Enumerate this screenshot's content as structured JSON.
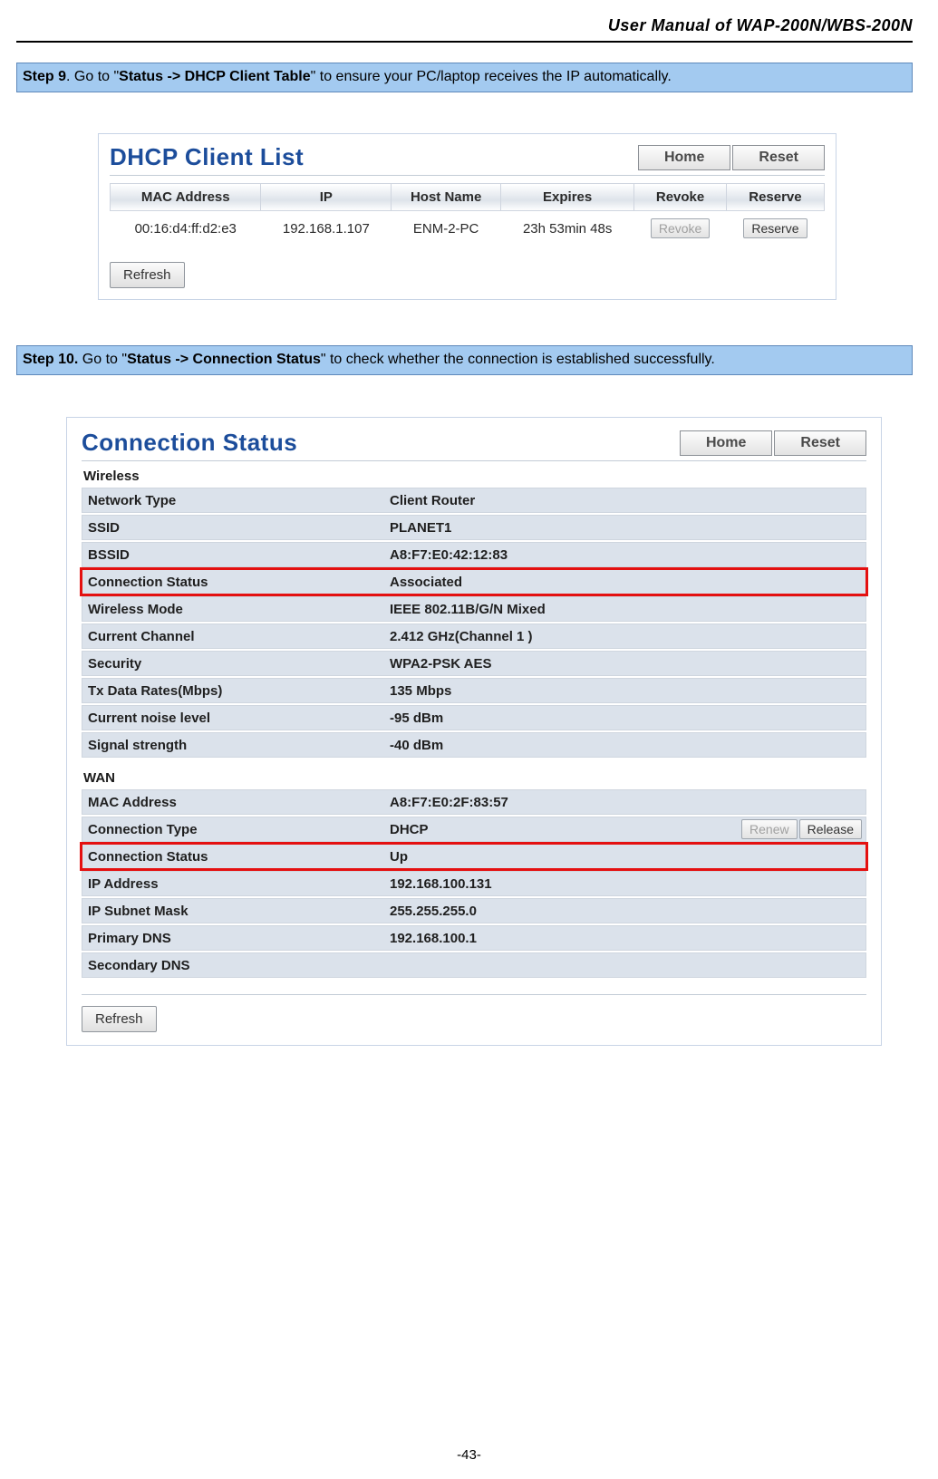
{
  "doc": {
    "header": "User Manual of WAP-200N/WBS-200N",
    "page_number": "-43-"
  },
  "step9": {
    "label": "Step 9",
    "text_before": ". Go to \"",
    "bold_path": "Status -> DHCP Client Table",
    "text_after": "\" to ensure your PC/laptop receives the IP automatically."
  },
  "step10": {
    "label": "Step 10.",
    "text_before": " Go to \"",
    "bold_path": "Status -> Connection Status",
    "text_after": "\" to check whether the connection is established successfully."
  },
  "dhcp": {
    "title": "DHCP Client List",
    "btn_home": "Home",
    "btn_reset": "Reset",
    "cols": {
      "mac": "MAC Address",
      "ip": "IP",
      "host": "Host Name",
      "expires": "Expires",
      "revoke": "Revoke",
      "reserve": "Reserve"
    },
    "row": {
      "mac": "00:16:d4:ff:d2:e3",
      "ip": "192.168.1.107",
      "host": "ENM-2-PC",
      "expires": "23h 53min 48s",
      "revoke_btn": "Revoke",
      "reserve_btn": "Reserve"
    },
    "refresh": "Refresh"
  },
  "conn": {
    "title": "Connection Status",
    "btn_home": "Home",
    "btn_reset": "Reset",
    "wireless_label": "Wireless",
    "wireless": {
      "network_type": {
        "k": "Network Type",
        "v": "Client Router"
      },
      "ssid": {
        "k": "SSID",
        "v": "PLANET1"
      },
      "bssid": {
        "k": "BSSID",
        "v": "A8:F7:E0:42:12:83"
      },
      "conn_status": {
        "k": "Connection Status",
        "v": "Associated"
      },
      "mode": {
        "k": "Wireless Mode",
        "v": "IEEE 802.11B/G/N Mixed"
      },
      "channel": {
        "k": "Current Channel",
        "v": "2.412 GHz(Channel 1 )"
      },
      "security": {
        "k": "Security",
        "v": "WPA2-PSK AES"
      },
      "tx": {
        "k": "Tx Data Rates(Mbps)",
        "v": "135 Mbps"
      },
      "noise": {
        "k": "Current noise level",
        "v": "-95 dBm"
      },
      "signal": {
        "k": "Signal strength",
        "v": "-40 dBm"
      }
    },
    "wan_label": "WAN",
    "wan": {
      "mac": {
        "k": "MAC Address",
        "v": "A8:F7:E0:2F:83:57"
      },
      "ctype": {
        "k": "Connection Type",
        "v": "DHCP"
      },
      "renew_btn": "Renew",
      "release_btn": "Release",
      "conn_status": {
        "k": "Connection Status",
        "v": "Up"
      },
      "ip": {
        "k": "IP Address",
        "v": "192.168.100.131"
      },
      "mask": {
        "k": "IP Subnet Mask",
        "v": "255.255.255.0"
      },
      "dns1": {
        "k": "Primary DNS",
        "v": "192.168.100.1"
      },
      "dns2": {
        "k": "Secondary DNS",
        "v": ""
      }
    },
    "refresh": "Refresh"
  }
}
